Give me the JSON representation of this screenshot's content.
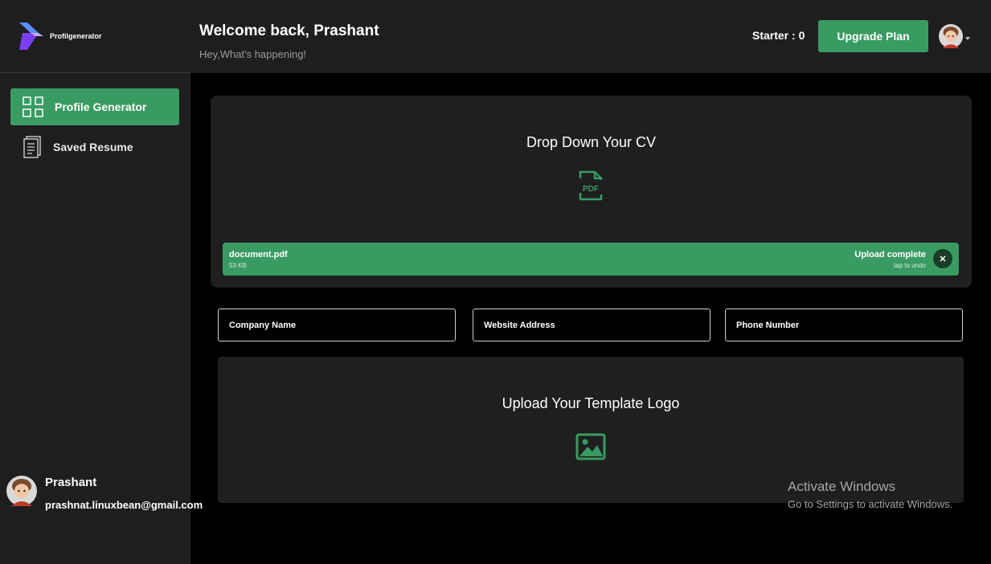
{
  "brand": {
    "name": "Profilgenerator"
  },
  "sidebar": {
    "items": [
      {
        "label": "Profile Generator",
        "icon": "grid-icon",
        "active": true
      },
      {
        "label": "Saved Resume",
        "icon": "document-icon",
        "active": false
      }
    ]
  },
  "user": {
    "name": "Prashant",
    "email": "prashnat.linuxbean@gmail.com"
  },
  "header": {
    "welcome": "Welcome back, Prashant",
    "subtitle": "Hey,What's happening!",
    "plan_label": "Starter : 0",
    "upgrade_label": "Upgrade Plan"
  },
  "upload": {
    "title": "Drop Down Your CV",
    "file": {
      "name": "document.pdf",
      "size": "53 KB",
      "status": "Upload complete",
      "undo_hint": "tap to undo",
      "close_glyph": "✕"
    }
  },
  "form": {
    "company_placeholder": "Company Name",
    "website_placeholder": "Website Address",
    "phone_placeholder": "Phone Number"
  },
  "logo_upload": {
    "title": "Upload Your Template Logo"
  },
  "watermark": {
    "title": "Activate Windows",
    "subtitle": "Go to Settings to activate Windows."
  },
  "colors": {
    "accent": "#3a9b62",
    "panel": "#1f1f1f",
    "sidebar": "#1e1e1e",
    "logo_purple": "#7b3ff2"
  }
}
